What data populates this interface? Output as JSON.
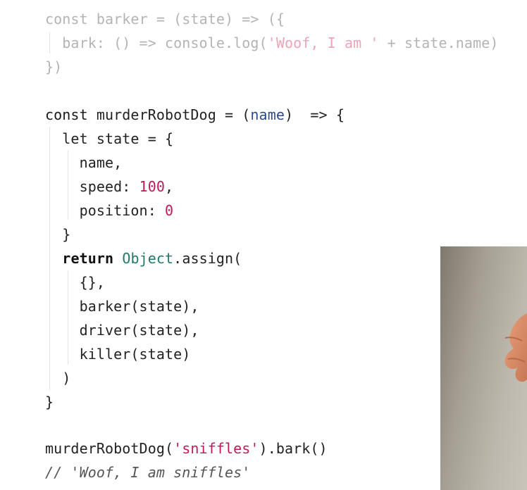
{
  "code": {
    "line1": {
      "a": "const",
      "b": " barker = (",
      "c": "state",
      "d": ") => ({"
    },
    "line2": {
      "a": "  bark: () => console.log(",
      "b": "'Woof, I am '",
      "c": " + state.name)"
    },
    "line3": {
      "a": "})"
    },
    "line5": {
      "a": "const",
      "b": " murderRobotDog = (",
      "c": "name",
      "d": ")  => {"
    },
    "line6": {
      "a": "  let state = {"
    },
    "line7": {
      "a": "    name,"
    },
    "line8": {
      "a": "    speed: ",
      "b": "100",
      ",c": ","
    },
    "line9": {
      "a": "    position: ",
      "b": "0"
    },
    "line10": {
      "a": "  }"
    },
    "line11": {
      "a": "  ",
      "b": "return",
      " c": " ",
      "d": "Object",
      ".e": ".assign("
    },
    "line12": {
      "a": "    {},"
    },
    "line13": {
      "a": "    barker(state),"
    },
    "line14": {
      "a": "    driver(state),"
    },
    "line15": {
      "a": "    killer(state)"
    },
    "line16": {
      "a": "  )"
    },
    "line17": {
      "a": "}"
    },
    "line19": {
      "a": "murderRobotDog(",
      "b": "'sniffles'",
      "c": ").bark()"
    },
    "line20": {
      "a": "// 'Woof, I am sniffles'"
    }
  },
  "colors": {
    "keyword": "#1a1a1a",
    "param": "#2c4a8c",
    "number": "#c2185b",
    "string": "#c2185b",
    "type": "#207a6c",
    "comment": "#555555",
    "faded": "#b4b4b4"
  }
}
